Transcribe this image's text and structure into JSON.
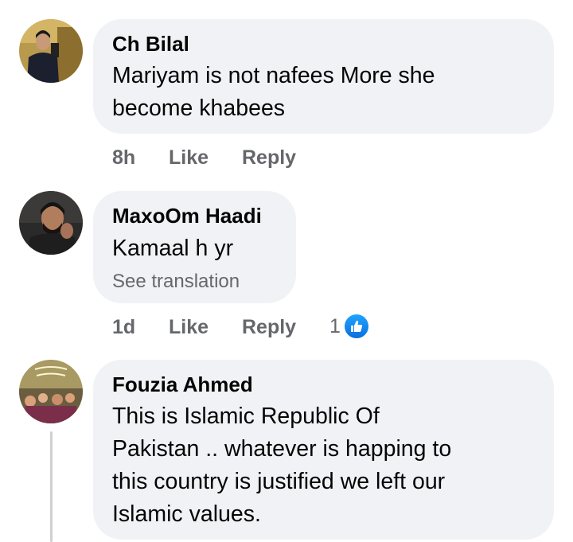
{
  "comments": [
    {
      "author": "Ch Bilal",
      "text_lines": [
        "Mariyam is not nafees More she",
        "become khabees"
      ],
      "time": "8h",
      "like_label": "Like",
      "reply_label": "Reply"
    },
    {
      "author": "MaxoOm Haadi",
      "text_lines": [
        "Kamaal h yr"
      ],
      "see_translation": "See translation",
      "time": "1d",
      "like_label": "Like",
      "reply_label": "Reply",
      "reaction_count": "1",
      "reaction_icon": "thumbs-up-icon"
    },
    {
      "author": "Fouzia Ahmed",
      "text_lines": [
        "This is Islamic Republic Of",
        "Pakistan .. whatever is happing to",
        "this country is justified we left our",
        "Islamic values."
      ]
    }
  ],
  "colors": {
    "bubble": "#f0f2f5",
    "meta_text": "#65676b",
    "like_blue": "#1877f2"
  }
}
